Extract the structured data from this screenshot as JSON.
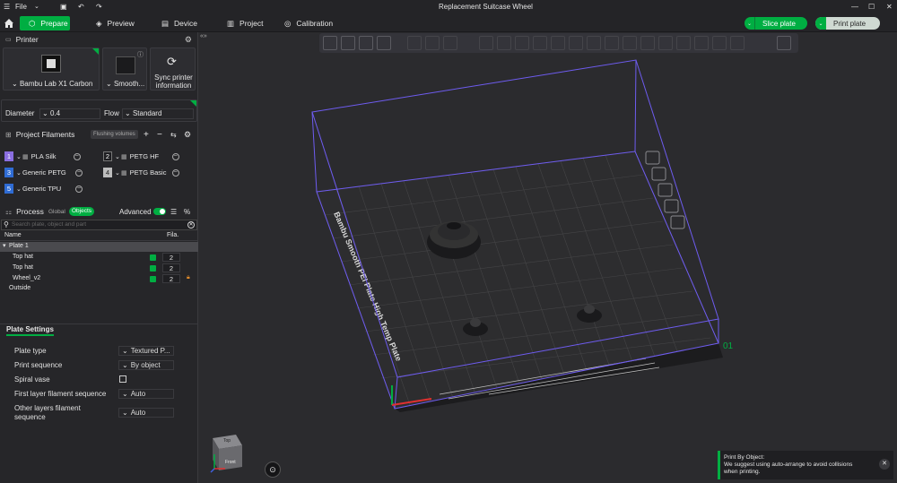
{
  "window": {
    "title": "Replacement Suitcase Wheel",
    "menu_label": "File"
  },
  "tabs": [
    {
      "label": "Prepare",
      "icon": "cube-icon"
    },
    {
      "label": "Preview",
      "icon": "layers-icon"
    },
    {
      "label": "Device",
      "icon": "device-icon"
    },
    {
      "label": "Project",
      "icon": "project-icon"
    },
    {
      "label": "Calibration",
      "icon": "calibration-icon"
    }
  ],
  "actions": {
    "slice_label": "Slice plate",
    "print_label": "Print plate"
  },
  "printer": {
    "section_title": "Printer",
    "printer_name": "Bambu Lab X1 Carbon",
    "plate_name": "Smooth...",
    "sync_label": "Sync printer information",
    "diameter_label": "Diameter",
    "diameter_value": "0.4",
    "flow_label": "Flow",
    "flow_value": "Standard"
  },
  "filaments": {
    "section_title": "Project Filaments",
    "flushing_label": "Flushing volumes",
    "items": [
      {
        "num": "1",
        "name": "PLA Silk",
        "color": "#8a6ee0"
      },
      {
        "num": "2",
        "name": "PETG HF",
        "color": "#1f1f22"
      },
      {
        "num": "3",
        "name": "Generic PETG",
        "color": "#2f6cd4"
      },
      {
        "num": "4",
        "name": "PETG Basic",
        "color": "#bdbdbd"
      },
      {
        "num": "5",
        "name": "Generic TPU",
        "color": "#2f6cd4"
      }
    ]
  },
  "process": {
    "section_title": "Process",
    "global_label": "Global",
    "objects_label": "Objects",
    "advanced_label": "Advanced",
    "search_placeholder": "Search plate, object and part",
    "col_name": "Name",
    "col_fila": "Fila.",
    "plate_label": "Plate 1",
    "objects": [
      {
        "name": "Top hat",
        "fila": "2"
      },
      {
        "name": "Top hat",
        "fila": "2"
      },
      {
        "name": "Wheel_v2",
        "fila": "2"
      }
    ],
    "outside_label": "Outside"
  },
  "plate_settings": {
    "title": "Plate Settings",
    "rows": [
      {
        "label": "Plate type",
        "value": "Textured P..."
      },
      {
        "label": "Print sequence",
        "value": "By object"
      },
      {
        "label": "Spiral vase",
        "value": ""
      },
      {
        "label": "First layer filament sequence",
        "value": "Auto"
      },
      {
        "label": "Other layers filament sequence",
        "value": "Auto"
      }
    ]
  },
  "viewport": {
    "bed_label": "Bambu Smooth PEI Plate High Temp Plate",
    "plate_number": "01",
    "cube_top": "Top",
    "cube_front": "Front"
  },
  "notification": {
    "title": "Print By Object:",
    "body": "We suggest using auto-arrange to avoid collisions when printing."
  },
  "colors": {
    "accent": "#00ae42",
    "volume": "#6e5cf0"
  }
}
